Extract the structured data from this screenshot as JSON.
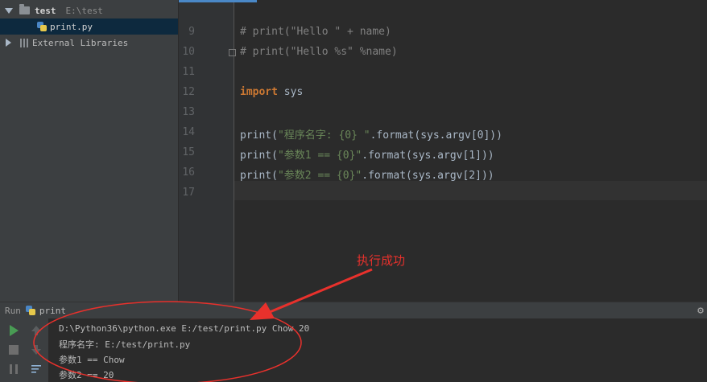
{
  "project": {
    "root_name": "test",
    "root_path": "E:\\test",
    "file_name": "print.py",
    "external_libraries": "External Libraries"
  },
  "editor": {
    "lines": [
      {
        "num": "9",
        "text": "# print(\"Hello \" + name)"
      },
      {
        "num": "10",
        "text": "# print(\"Hello %s\" %name)"
      },
      {
        "num": "11",
        "text": ""
      },
      {
        "num": "12",
        "keyword": "import",
        "rest": " sys"
      },
      {
        "num": "13",
        "text": ""
      },
      {
        "num": "14",
        "func": "print(",
        "str": "\"程序名字: {0} \"",
        "rest": ".format(sys.argv[0]))"
      },
      {
        "num": "15",
        "func": "print(",
        "str": "\"参数1 == {0}\"",
        "rest": ".format(sys.argv[1]))"
      },
      {
        "num": "16",
        "func": "print(",
        "str": "\"参数2 == {0}\"",
        "rest": ".format(sys.argv[2]))"
      },
      {
        "num": "17",
        "text": ""
      }
    ]
  },
  "annotation": {
    "text": "执行成功",
    "color": "#e8312c"
  },
  "run": {
    "label": "Run",
    "config_name": "print",
    "output": [
      "D:\\Python36\\python.exe E:/test/print.py Chow 20",
      "程序名字: E:/test/print.py",
      "参数1 == Chow",
      "参数2 == 20"
    ]
  },
  "icons": [
    "folder-icon",
    "python-file-icon",
    "library-icon",
    "run-icon",
    "stop-icon",
    "pause-icon",
    "up-arrow-icon",
    "down-arrow-icon",
    "soft-wrap-icon",
    "gear-icon"
  ],
  "colors": {
    "accent": "#4a88c7",
    "keyword": "#cc7832",
    "string": "#6a8759",
    "comment": "#808080",
    "run_green": "#499c54"
  }
}
